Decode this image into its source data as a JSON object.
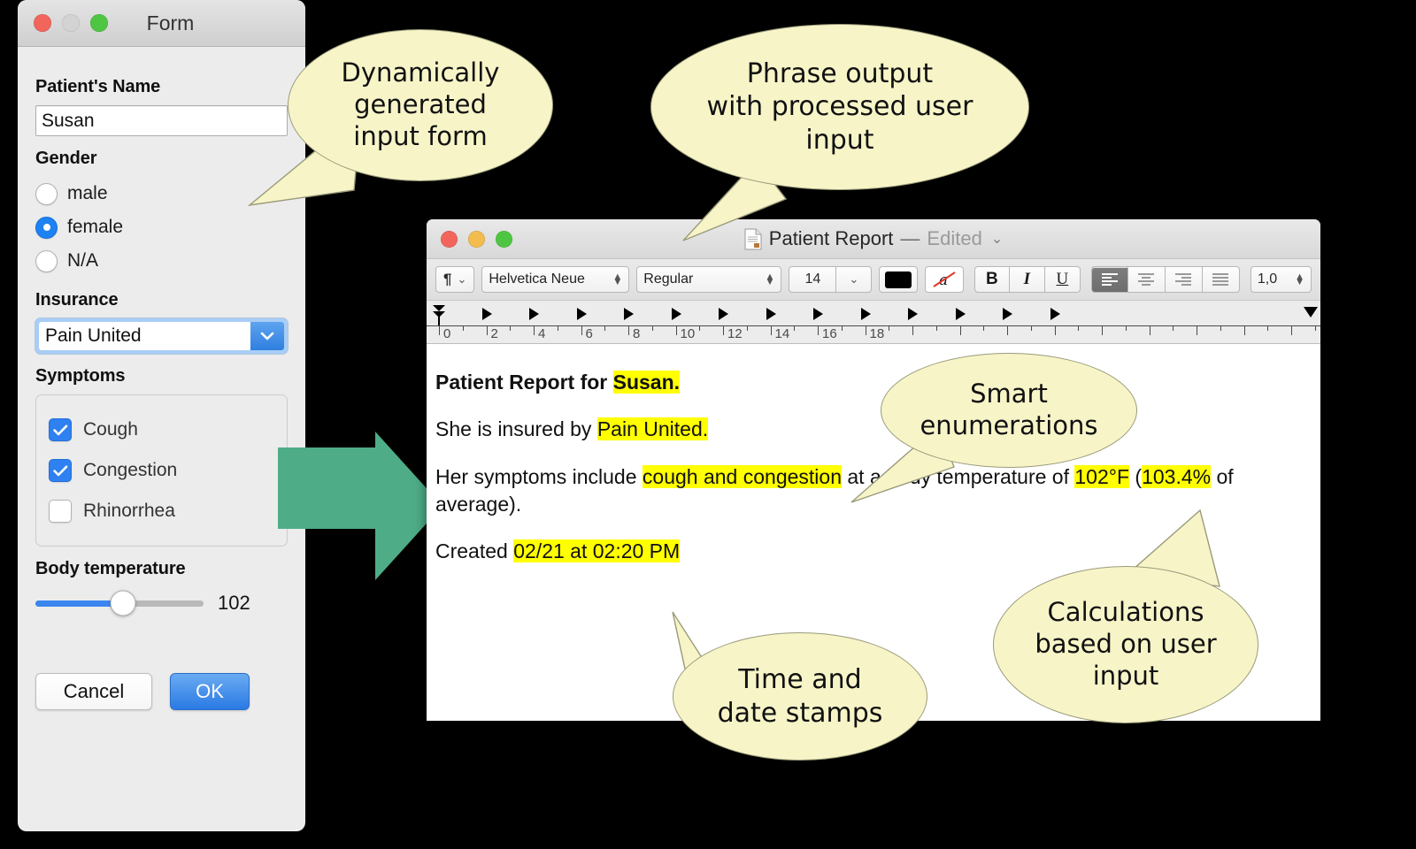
{
  "form_window": {
    "title": "Form",
    "traffic_lights": [
      "close-red",
      "minimize-grey",
      "zoom-green"
    ],
    "fields": {
      "name_label": "Patient's Name",
      "name_value": "Susan",
      "gender_label": "Gender",
      "gender_options": [
        "male",
        "female",
        "N/A"
      ],
      "gender_selected": "female",
      "insurance_label": "Insurance",
      "insurance_value": "Pain United",
      "symptoms_label": "Symptoms",
      "symptoms": [
        {
          "label": "Cough",
          "checked": true
        },
        {
          "label": "Congestion",
          "checked": true
        },
        {
          "label": "Rhinorrhea",
          "checked": false
        }
      ],
      "temperature_label": "Body temperature",
      "temperature_value": "102",
      "temperature_percent": 52
    },
    "buttons": {
      "cancel": "Cancel",
      "ok": "OK"
    }
  },
  "textedit_window": {
    "traffic_lights": [
      "close-red",
      "minimize-yellow",
      "zoom-green"
    ],
    "title": "Patient Report",
    "dash": "—",
    "edited": "Edited",
    "chevron": "⌄",
    "toolbar": {
      "paragraph_style": "¶",
      "paragraph_chevron": "⌄",
      "font_family": "Helvetica Neue",
      "font_style": "Regular",
      "font_size": "14",
      "size_chevron": "⌄",
      "text_color": "#000000",
      "highlight_label": "a",
      "bold": "B",
      "italic": "I",
      "underline": "U",
      "align": [
        "align-left",
        "align-center",
        "align-right",
        "align-justify"
      ],
      "align_active": "align-left",
      "line_spacing": "1,0"
    },
    "ruler": {
      "labels": [
        "0",
        "2",
        "4",
        "6",
        "8",
        "10",
        "12",
        "14",
        "16",
        "18"
      ]
    },
    "document": {
      "paragraphs": [
        {
          "bold": true,
          "runs": [
            {
              "text": "Patient Report for ",
              "hl": false
            },
            {
              "text": "Susan.",
              "hl": true
            }
          ]
        },
        {
          "bold": false,
          "runs": [
            {
              "text": "She is insured by ",
              "hl": false
            },
            {
              "text": "Pain United.",
              "hl": true
            }
          ]
        },
        {
          "bold": false,
          "runs": [
            {
              "text": "Her symptoms include ",
              "hl": false
            },
            {
              "text": "cough and congestion",
              "hl": true
            },
            {
              "text": " at a body temperature of ",
              "hl": false
            },
            {
              "text": "102°F",
              "hl": true
            },
            {
              "text": " (",
              "hl": false
            },
            {
              "text": "103.4%",
              "hl": true
            },
            {
              "text": " of average).",
              "hl": false
            }
          ]
        },
        {
          "bold": false,
          "runs": [
            {
              "text": "Created ",
              "hl": false
            },
            {
              "text": "02/21 at 02:20 PM",
              "hl": true
            }
          ]
        }
      ]
    }
  },
  "callouts": [
    {
      "id": "dynamically-generated-input-form",
      "lines": [
        "Dynamically",
        "generated",
        "input form"
      ]
    },
    {
      "id": "phrase-output",
      "lines": [
        "Phrase output",
        "with processed user",
        "input"
      ]
    },
    {
      "id": "smart-enumerations",
      "lines": [
        "Smart",
        "enumerations"
      ]
    },
    {
      "id": "calculations",
      "lines": [
        "Calculations",
        "based on user",
        "input"
      ]
    },
    {
      "id": "time-and-date-stamps",
      "lines": [
        "Time and",
        "date stamps"
      ]
    }
  ],
  "colors": {
    "arrow_green": "#4EAD86",
    "highlight_yellow": "#FFFF00",
    "accent_blue": "#2F80F0",
    "callout_fill": "#F7F5C8",
    "callout_stroke": "#9A9A7A",
    "background": "#000000"
  }
}
